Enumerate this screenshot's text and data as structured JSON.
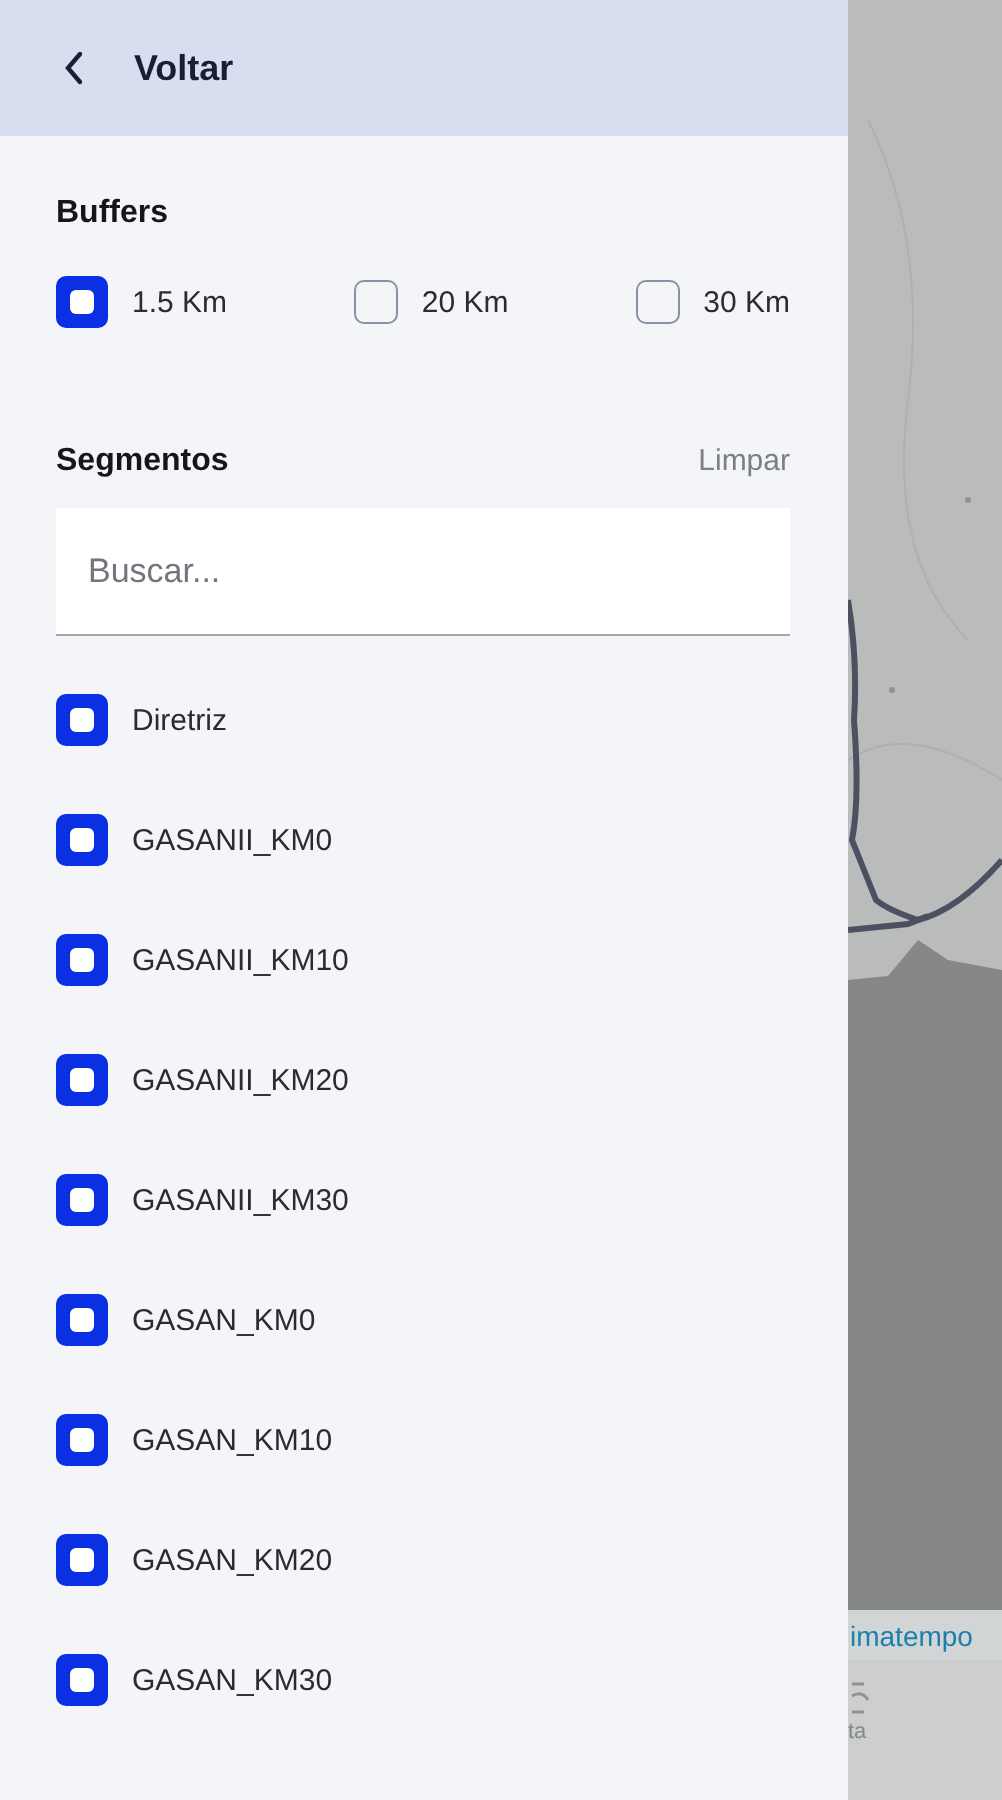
{
  "header": {
    "back_label": "Voltar"
  },
  "buffers": {
    "title": "Buffers",
    "options": [
      {
        "label": "1.5 Km",
        "checked": true
      },
      {
        "label": "20 Km",
        "checked": false
      },
      {
        "label": "30 Km",
        "checked": false
      }
    ]
  },
  "segments": {
    "title": "Segmentos",
    "clear_label": "Limpar",
    "search": {
      "placeholder": "Buscar..."
    },
    "items": [
      {
        "label": "Diretriz",
        "checked": true
      },
      {
        "label": "GASANII_KM0",
        "checked": true
      },
      {
        "label": "GASANII_KM10",
        "checked": true
      },
      {
        "label": "GASANII_KM20",
        "checked": true
      },
      {
        "label": "GASANII_KM30",
        "checked": true
      },
      {
        "label": "GASAN_KM0",
        "checked": true
      },
      {
        "label": "GASAN_KM10",
        "checked": true
      },
      {
        "label": "GASAN_KM20",
        "checked": true
      },
      {
        "label": "GASAN_KM30",
        "checked": true
      }
    ]
  },
  "map": {
    "attribution": "imatempo",
    "nav_label": "ta"
  }
}
